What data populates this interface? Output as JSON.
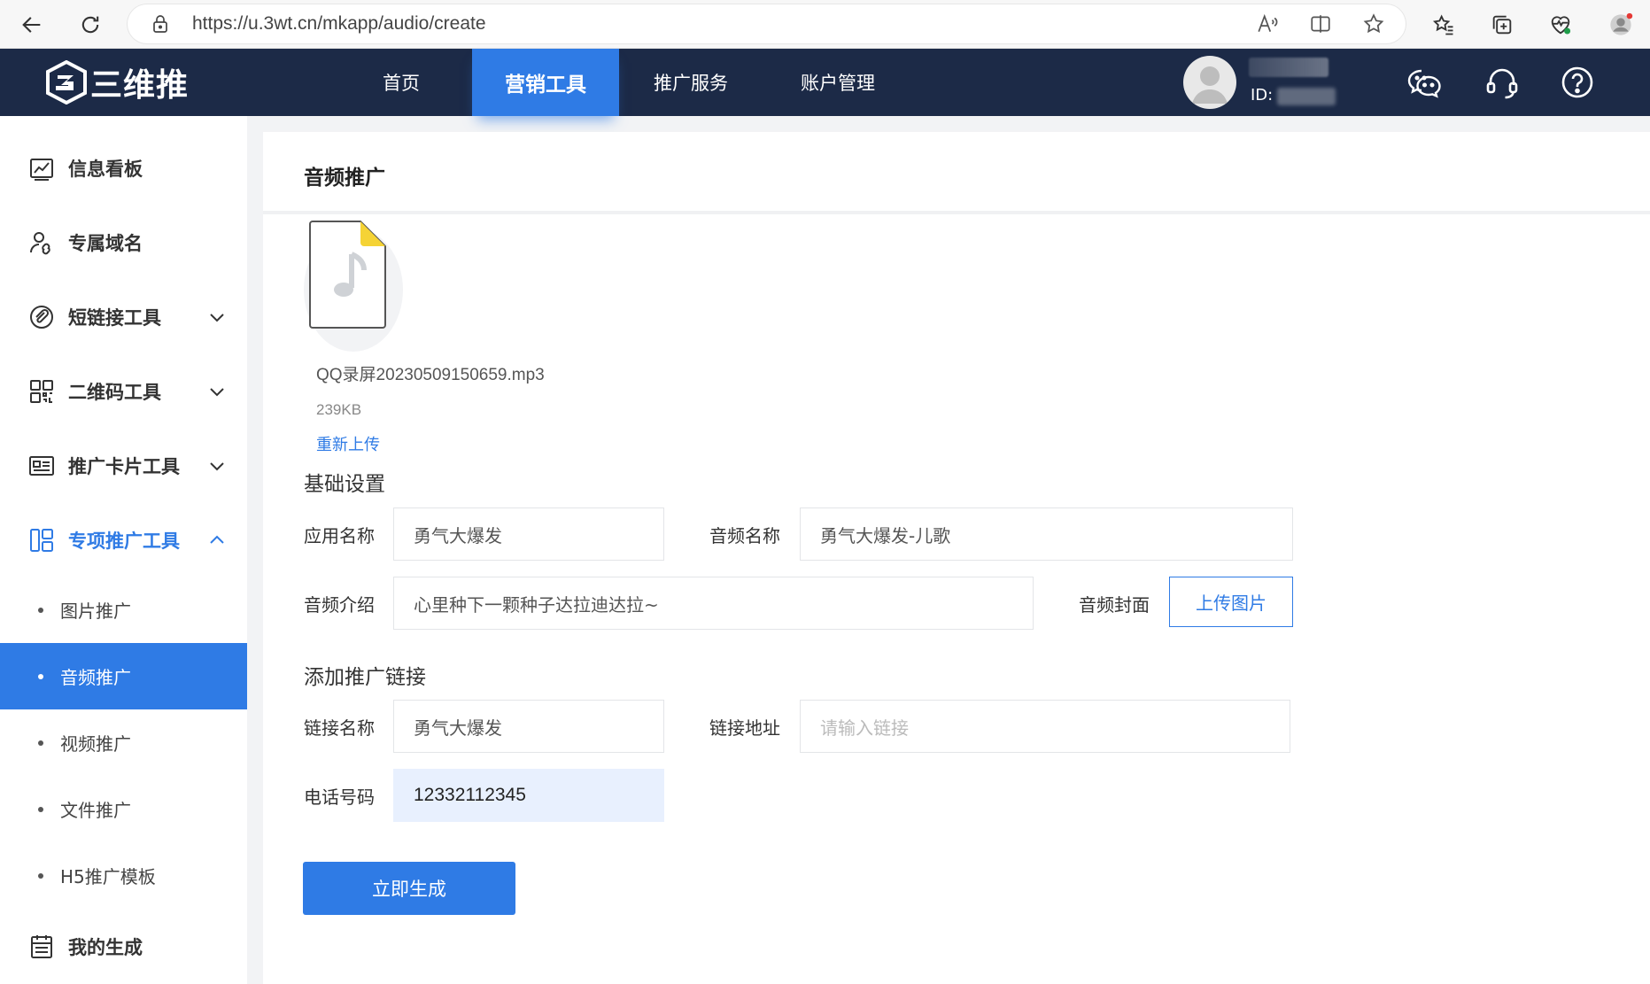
{
  "browser": {
    "url": "https://u.3wt.cn/mkapp/audio/create"
  },
  "header": {
    "logo_text": "三维推",
    "nav": [
      {
        "label": "首页"
      },
      {
        "label": "营销工具"
      },
      {
        "label": "推广服务"
      },
      {
        "label": "账户管理"
      }
    ],
    "user": {
      "id_label": "ID:"
    }
  },
  "sidebar": {
    "items": [
      {
        "label": "信息看板"
      },
      {
        "label": "专属域名"
      },
      {
        "label": "短链接工具"
      },
      {
        "label": "二维码工具"
      },
      {
        "label": "推广卡片工具"
      },
      {
        "label": "专项推广工具"
      },
      {
        "label": "我的生成"
      }
    ],
    "sub_items": [
      {
        "label": "图片推广"
      },
      {
        "label": "音频推广"
      },
      {
        "label": "视频推广"
      },
      {
        "label": "文件推广"
      },
      {
        "label": "H5推广模板"
      }
    ]
  },
  "main": {
    "title": "音频推广",
    "file": {
      "name": "QQ录屏20230509150659.mp3",
      "size": "239KB",
      "reupload": "重新上传"
    },
    "basic": {
      "title": "基础设置",
      "app_name_label": "应用名称",
      "app_name_value": "勇气大爆发",
      "audio_name_label": "音频名称",
      "audio_name_value": "勇气大爆发-儿歌",
      "intro_label": "音频介绍",
      "intro_value": "心里种下一颗种子达拉迪达拉~",
      "cover_label": "音频封面",
      "cover_button": "上传图片"
    },
    "link": {
      "title": "添加推广链接",
      "link_name_label": "链接名称",
      "link_name_value": "勇气大爆发",
      "link_url_label": "链接地址",
      "link_url_placeholder": "请输入链接",
      "phone_label": "电话号码",
      "phone_value": "12332112345"
    },
    "submit": "立即生成"
  },
  "colors": {
    "header_bg": "#1c2a47",
    "accent": "#2f7be5"
  }
}
